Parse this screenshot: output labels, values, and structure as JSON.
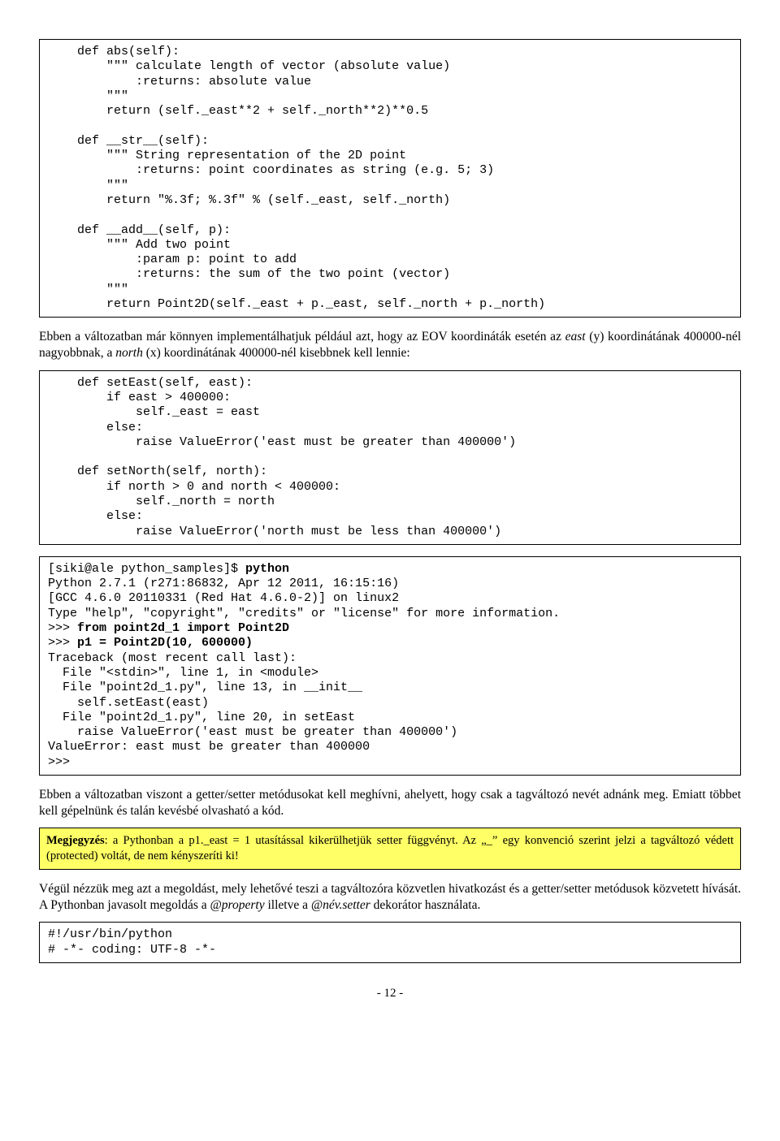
{
  "code1": "    def abs(self):\n        \"\"\" calculate length of vector (absolute value)\n            :returns: absolute value\n        \"\"\"\n        return (self._east**2 + self._north**2)**0.5\n\n    def __str__(self):\n        \"\"\" String representation of the 2D point\n            :returns: point coordinates as string (e.g. 5; 3)\n        \"\"\"\n        return \"%.3f; %.3f\" % (self._east, self._north)\n\n    def __add__(self, p):\n        \"\"\" Add two point\n            :param p: point to add\n            :returns: the sum of the two point (vector)\n        \"\"\"\n        return Point2D(self._east + p._east, self._north + p._north)",
  "para1_a": "Ebben a változatban már könnyen implementálhatjuk például azt, hogy az EOV koordináták esetén az ",
  "para1_east": "east",
  "para1_b": " (y) koordinátának 400000-nél nagyobbnak, a ",
  "para1_north": "north",
  "para1_c": " (x) koordinátának 400000-nél kisebbnek kell lennie:",
  "code2": "    def setEast(self, east):\n        if east > 400000:\n            self._east = east\n        else:\n            raise ValueError('east must be greater than 400000')\n\n    def setNorth(self, north):\n        if north > 0 and north < 400000:\n            self._north = north\n        else:\n            raise ValueError('north must be less than 400000')",
  "code3_a": "[siki@ale python_samples]$ ",
  "code3_python": "python",
  "code3_b": "\nPython 2.7.1 (r271:86832, Apr 12 2011, 16:15:16)\n[GCC 4.6.0 20110331 (Red Hat 4.6.0-2)] on linux2\nType \"help\", \"copyright\", \"credits\" or \"license\" for more information.\n>>> ",
  "code3_import": "from point2d_1 import Point2D",
  "code3_c": "\n>>> ",
  "code3_p1": "p1 = Point2D(10, 600000)",
  "code3_d": "\nTraceback (most recent call last):\n  File \"<stdin>\", line 1, in <module>\n  File \"point2d_1.py\", line 13, in __init__\n    self.setEast(east)\n  File \"point2d_1.py\", line 20, in setEast\n    raise ValueError('east must be greater than 400000')\nValueError: east must be greater than 400000\n>>>",
  "para2": "Ebben a változatban viszont a getter/setter metódusokat kell meghívni, ahelyett, hogy csak a tagváltozó nevét adnánk meg. Emiatt többet kell gépelnünk és talán kevésbé olvasható a kód.",
  "note_bold": "Megjegyzés",
  "note_text": ": a Pythonban a p1._east = 1 utasítással kikerülhetjük setter függvényt. Az „_” egy konvenció szerint jelzi a tagváltozó védett (protected) voltát, de nem kényszeríti ki!",
  "para3_a": "Végül nézzük meg azt a megoldást, mely lehetővé teszi a tagváltozóra közvetlen hivatkozást és a getter/setter metódusok közvetett hívását. A Pythonban javasolt megoldás a ",
  "para3_prop": "@property",
  "para3_b": " illetve a ",
  "para3_setter": "@név.setter",
  "para3_c": " dekorátor használata.",
  "code4": "#!/usr/bin/python\n# -*- coding: UTF-8 -*-",
  "pagenum": "- 12 -"
}
